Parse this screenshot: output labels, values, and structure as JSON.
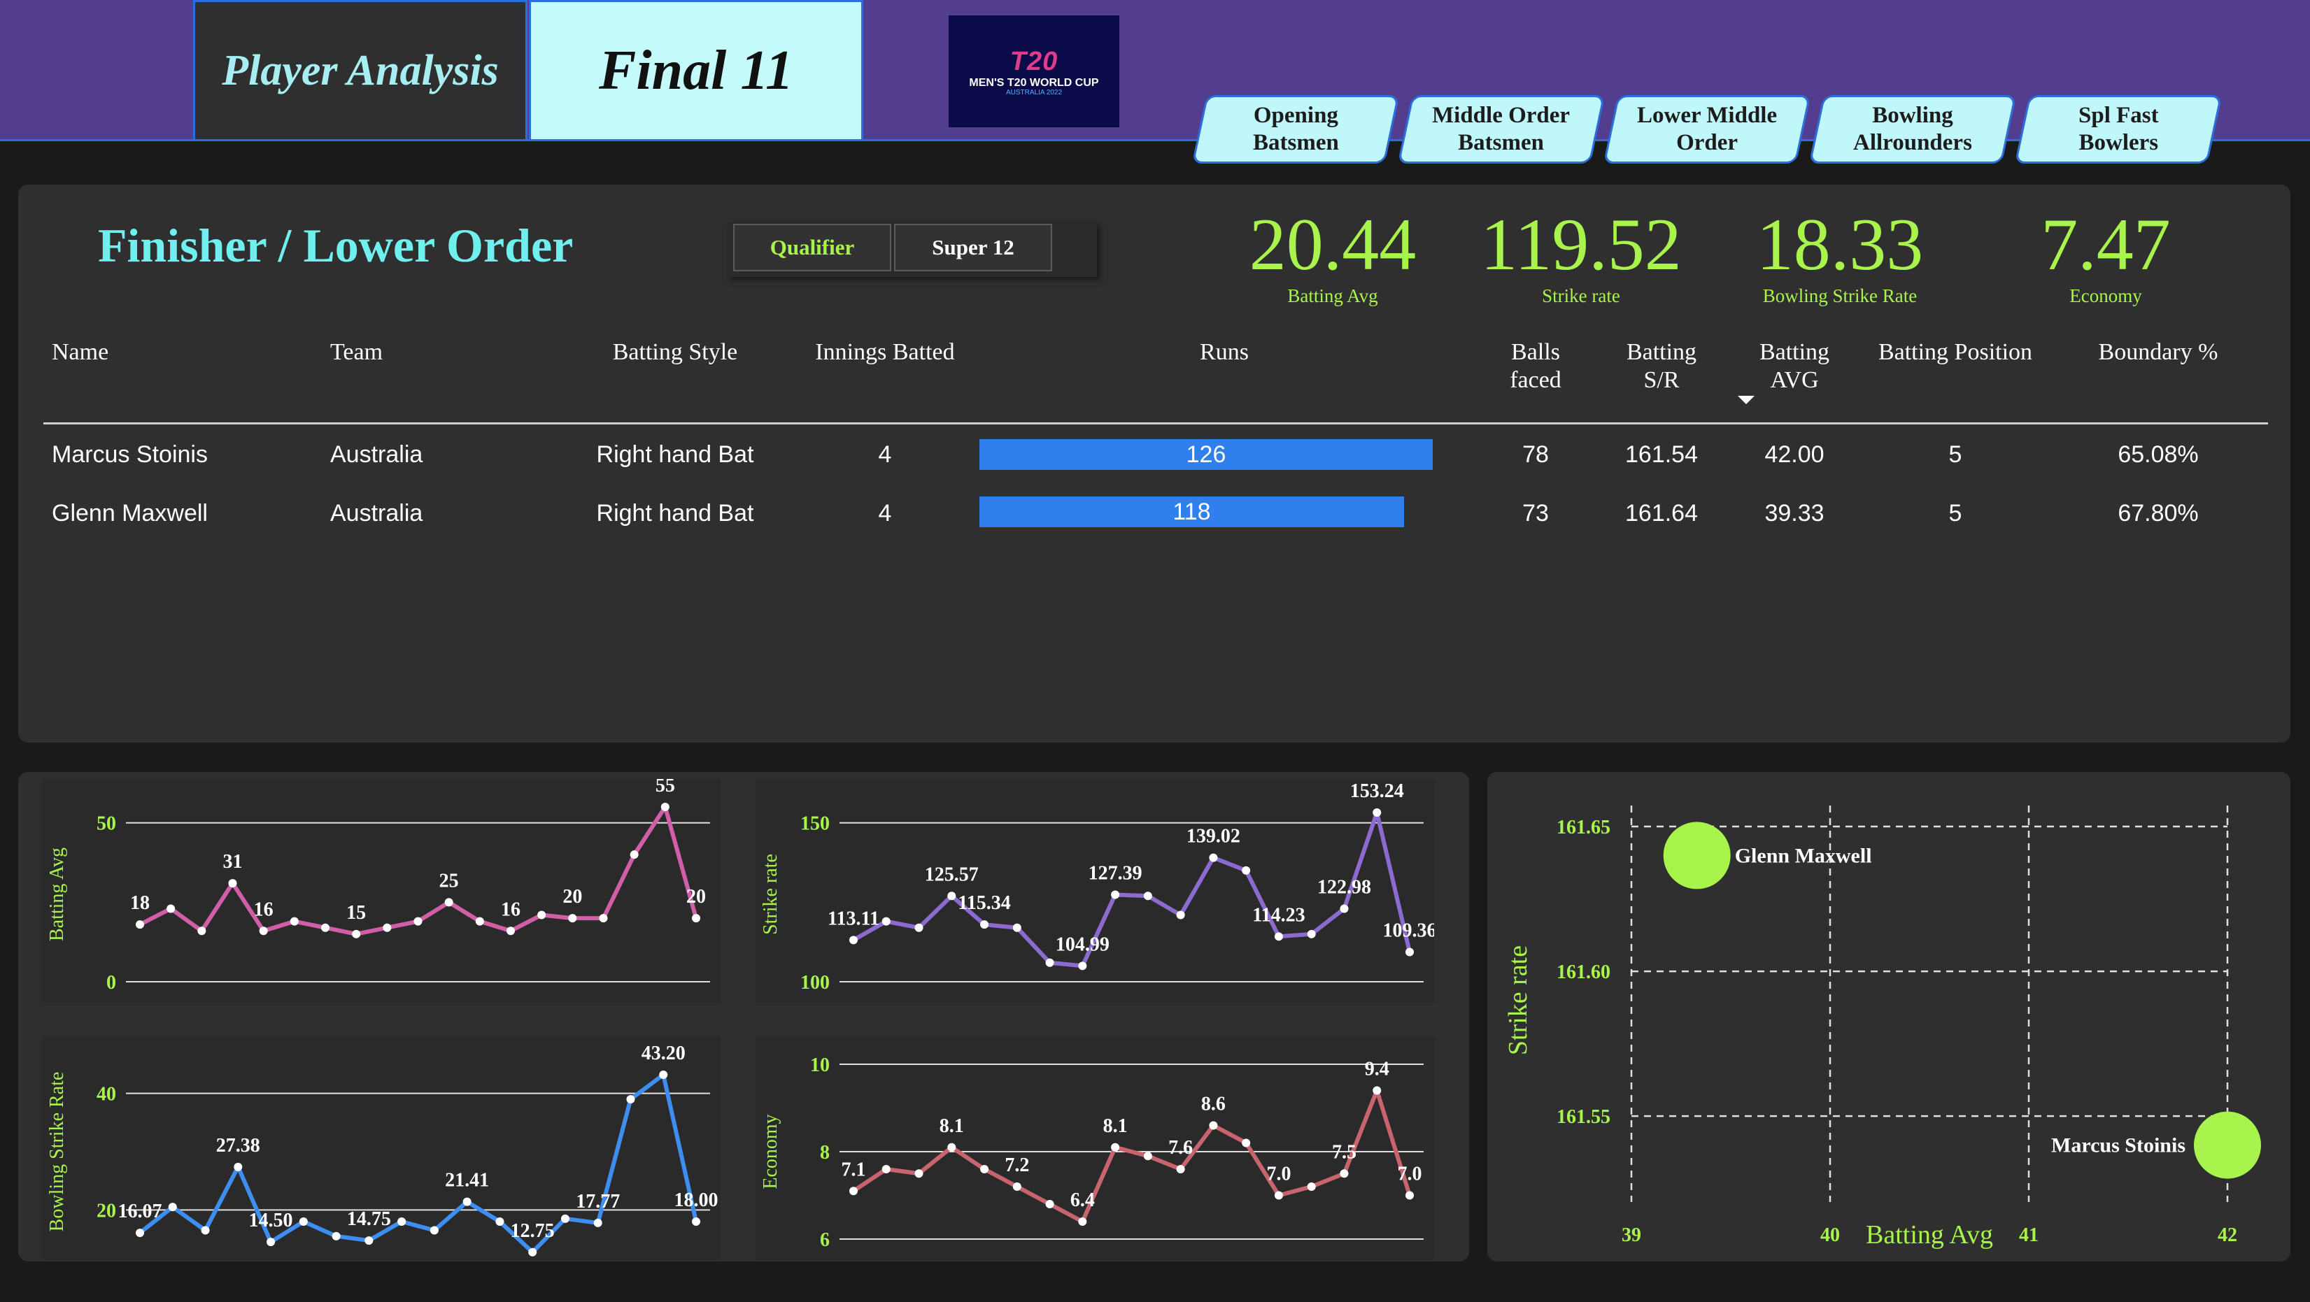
{
  "header": {
    "tab_player_analysis": "Player Analysis",
    "tab_final_11": "Final 11",
    "logo": {
      "line1": "T20",
      "line2": "MEN'S T20 WORLD CUP",
      "line3": "AUSTRALIA 2022"
    },
    "nav": [
      {
        "label": "Opening\nBatsmen"
      },
      {
        "label": "Middle Order\nBatsmen"
      },
      {
        "label": "Lower Middle\nOrder"
      },
      {
        "label": "Bowling\nAllrounders"
      },
      {
        "label": "Spl Fast\nBowlers"
      }
    ]
  },
  "section": {
    "title": "Finisher / Lower Order",
    "filters": [
      "Qualifier",
      "Super 12"
    ]
  },
  "kpis": [
    {
      "value": "20.44",
      "label": "Batting Avg"
    },
    {
      "value": "119.52",
      "label": "Strike rate"
    },
    {
      "value": "18.33",
      "label": "Bowling Strike Rate"
    },
    {
      "value": "7.47",
      "label": "Economy"
    }
  ],
  "table": {
    "columns": [
      "Name",
      "Team",
      "Batting Style",
      "Innings Batted",
      "Runs",
      "Balls\nfaced",
      "Batting\nS/R",
      "Batting\nAVG",
      "Batting Position",
      "Boundary %"
    ],
    "rows": [
      {
        "name": "Marcus Stoinis",
        "team": "Australia",
        "style": "Right hand Bat",
        "innings": "4",
        "runs": "126",
        "balls": "78",
        "sr": "161.54",
        "avg": "42.00",
        "pos": "5",
        "boundary": "65.08%"
      },
      {
        "name": "Glenn Maxwell",
        "team": "Australia",
        "style": "Right hand Bat",
        "innings": "4",
        "runs": "118",
        "balls": "73",
        "sr": "161.64",
        "avg": "39.33",
        "pos": "5",
        "boundary": "67.80%"
      }
    ],
    "runs_max": 126
  },
  "colors": {
    "kpi_green": "#a8f34c",
    "title_cyan": "#6ff0ef",
    "bar_blue": "#2f80ed",
    "line_pink": "#d05fa8",
    "line_purple": "#8c6ad0",
    "line_blue": "#3d8ef0",
    "line_red": "#c8646e"
  },
  "chart_data": [
    {
      "type": "line",
      "ylabel": "Batting Avg",
      "ylim": [
        0,
        55
      ],
      "yticks": [
        0,
        50
      ],
      "values": [
        18,
        23,
        16,
        31,
        16,
        19,
        17,
        15,
        17,
        19,
        25,
        19,
        16,
        21,
        20,
        20,
        40,
        55,
        20
      ],
      "labels": [
        "18",
        "",
        "",
        "31",
        "16",
        "",
        "",
        "15",
        "",
        "",
        "25",
        "",
        "16",
        "",
        "20",
        "",
        "",
        "55",
        "20"
      ]
    },
    {
      "type": "line",
      "ylabel": "Strike rate",
      "ylim": [
        100,
        155
      ],
      "yticks": [
        100,
        150
      ],
      "values": [
        113.11,
        119,
        117,
        127,
        118,
        117,
        106,
        104.99,
        127.39,
        127,
        121,
        139.02,
        135,
        114.23,
        115,
        122.98,
        153.24,
        109.36
      ],
      "labels": [
        "113.11",
        "",
        "",
        "125.57",
        "115.34",
        "",
        "",
        "104.99",
        "127.39",
        "",
        "",
        "139.02",
        "",
        "114.23",
        "",
        "122.98",
        "153.24",
        "109.36"
      ]
    },
    {
      "type": "line",
      "ylabel": "Bowling Strike Rate",
      "ylim": [
        15,
        45
      ],
      "yticks": [
        20,
        40
      ],
      "values": [
        16.07,
        20.5,
        16.5,
        27.38,
        14.5,
        18,
        15.5,
        14.75,
        18,
        16.5,
        21.41,
        18,
        12.75,
        18.5,
        17.77,
        39,
        43.2,
        18
      ],
      "labels": [
        "16.07",
        "",
        "",
        "27.38",
        "14.50",
        "",
        "",
        "14.75",
        "",
        "",
        "21.41",
        "",
        "12.75",
        "",
        "17.77",
        "",
        "43.20",
        "18.00"
      ]
    },
    {
      "type": "line",
      "ylabel": "Economy",
      "ylim": [
        6,
        10
      ],
      "yticks": [
        6,
        8,
        10
      ],
      "values": [
        7.1,
        7.6,
        7.5,
        8.1,
        7.6,
        7.2,
        6.8,
        6.4,
        8.1,
        7.9,
        7.6,
        8.6,
        8.2,
        7.0,
        7.2,
        7.5,
        9.4,
        7.0
      ],
      "labels": [
        "7.1",
        "",
        "",
        "8.1",
        "",
        "7.2",
        "",
        "6.4",
        "8.1",
        "",
        "7.6",
        "8.6",
        "",
        "7.0",
        "",
        "7.5",
        "9.4",
        "7.0"
      ]
    },
    {
      "type": "scatter",
      "xlabel": "Batting Avg",
      "ylabel": "Strike rate",
      "xlim": [
        39,
        42
      ],
      "ylim": [
        161.53,
        161.65
      ],
      "xticks": [
        39,
        40,
        41,
        42
      ],
      "yticks": [
        161.55,
        161.6,
        161.65
      ],
      "points": [
        {
          "name": "Glenn Maxwell",
          "x": 39.33,
          "y": 161.64
        },
        {
          "name": "Marcus Stoinis",
          "x": 42.0,
          "y": 161.54
        }
      ]
    }
  ]
}
